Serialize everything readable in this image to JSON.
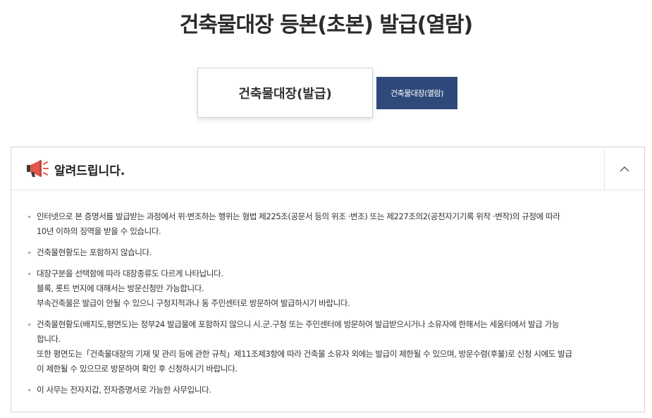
{
  "page": {
    "title": "건축물대장 등본(초본) 발급(열람)"
  },
  "tabs": {
    "issue_label": "건축물대장(발급)",
    "view_label": "건축물대장(열람)"
  },
  "notice": {
    "title": "알려드립니다.",
    "items": [
      {
        "lines": [
          "인터넷으로 본 증명서를 발급받는 과정에서 위·변조하는 행위는 형법 제225조(공문서 등의 위조 ·변조) 또는 제227조의2(공전자기기록 위작 ·변작)의 규정에 따라",
          "10년 이하의 징역을 받을 수 있습니다."
        ]
      },
      {
        "lines": [
          "건축물현황도는 포함하지 않습니다."
        ]
      },
      {
        "lines": [
          "대장구분을 선택함에 따라 대장종류도 다르게 나타납니다.",
          "블록, 롯트 번지에 대해서는 방문신청만 가능합니다.",
          "부속건축물은 발급이 안될 수 있으니 구청지적과나 동 주민센터로 방문하여 발급하시기 바랍니다."
        ]
      },
      {
        "lines": [
          "건축물현황도(배치도,평면도)는 정부24 발급물에 포함하지 않으니 시.군.구청 또는 주민센터에 방문하여 발급받으시거나 소유자에 한해서는 세움터에서 발급 가능",
          "합니다.",
          "또한 평면도는「건축물대장의 기재 및 관리 등에 관한 규칙」제11조제3항에 따라 건축물 소유자 외에는 발급이 제한될 수 있으며, 방문수령(후불)로 신청 시에도 발급",
          "이 제한될 수 있으므로 방문하여 확인 후 신청하시기 바랍니다."
        ]
      },
      {
        "lines": [
          "이 사무는 전자지갑, 전자증명서로 가능한 사무입니다."
        ]
      }
    ]
  },
  "icons": {
    "notice_icon": "megaphone-icon",
    "toggle_icon": "chevron-up-icon"
  },
  "colors": {
    "accent": "#2f4a7a",
    "megaphone": "#e2574c"
  }
}
